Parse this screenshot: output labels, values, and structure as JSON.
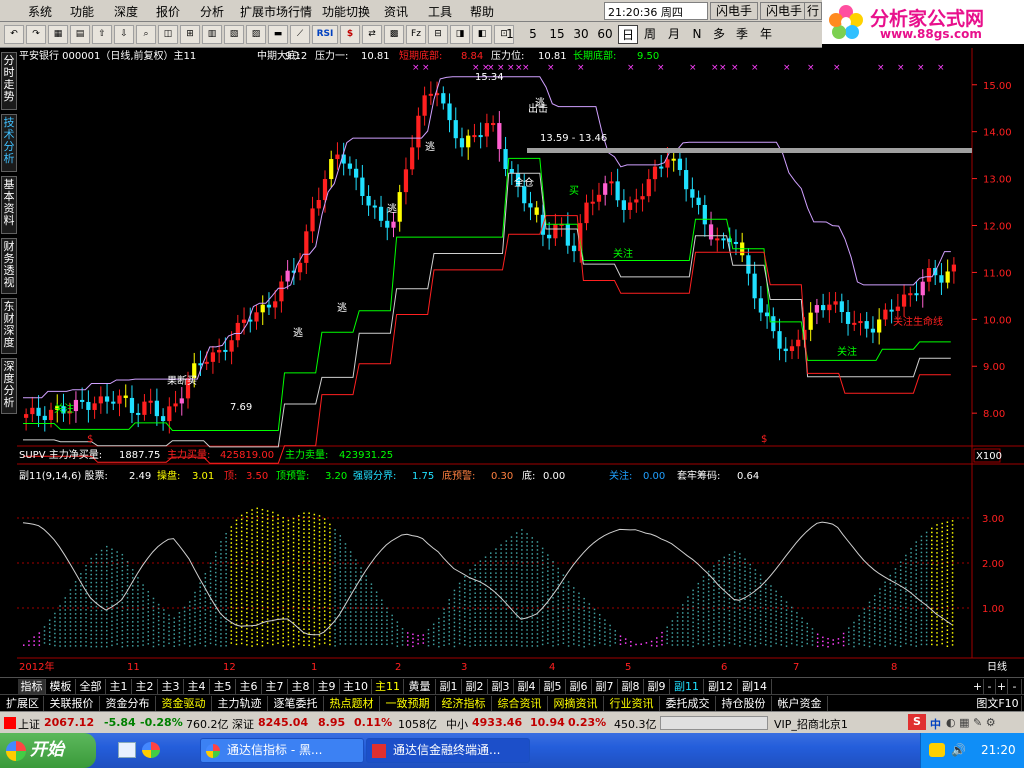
{
  "menubar": {
    "items": [
      "系统",
      "功能",
      "深度",
      "报价",
      "分析",
      "扩展市场行情",
      "功能切换",
      "资讯",
      "工具",
      "帮助"
    ],
    "clock": "21:20:36 周四",
    "buttons": [
      "闪电手",
      "闪电手",
      "行情",
      "资"
    ]
  },
  "logo": {
    "title": "分析家公式网",
    "url": "www.88gs.com"
  },
  "toolbar": {
    "icons": [
      "↶",
      "↷",
      "▦",
      "▤",
      "⇧",
      "⇩",
      "⌕",
      "◫",
      "⊞",
      "▥",
      "▧",
      "▨",
      "▬",
      "⟋",
      "RSI",
      "$",
      "⇄",
      "▩",
      "Fz",
      "⊟",
      "◨",
      "◧",
      "⊡"
    ],
    "periods": [
      "1",
      "5",
      "15",
      "30",
      "60",
      "日",
      "周",
      "月",
      "N",
      "多",
      "季",
      "年"
    ],
    "active_period": "日"
  },
  "sidetabs": [
    "分时走势",
    "技术分析",
    "基本资料",
    "财务透视",
    "东财深度",
    "深度分析"
  ],
  "main_header": {
    "stock": "平安银行 000001（日线,前复权）主11",
    "f1_label": "中期大底:",
    "f1_val": "9.12",
    "f2_label": "压力一:",
    "f2_val": "10.81",
    "f3_label": "短期底部:",
    "f3_val": "8.84",
    "f4_label": "压力位:",
    "f4_val": "10.81",
    "f5_label": "长期底部:",
    "f5_val": "9.50"
  },
  "price_axis": [
    "15.00",
    "14.00",
    "13.00",
    "12.00",
    "11.00",
    "10.00",
    "9.00",
    "8.00"
  ],
  "annotations": {
    "peak": "15.34",
    "escape": "逃",
    "strike": "出击",
    "full": "全仓",
    "buy": "买",
    "watch": "关注",
    "range": "13.59 - 13.46",
    "low": "7.69",
    "cut": "果断买",
    "lifeline": "关注生命线",
    "s_mark": "$"
  },
  "vol_header": {
    "name": "SUPV 主力净买量:",
    "net": "1887.75",
    "buy_label": "主力买量:",
    "buy": "425819.00",
    "sell_label": "主力卖量:",
    "sell": "423931.25"
  },
  "vol_scale": "X100",
  "sub_header": {
    "name": "副11(9,14,6) 股票:",
    "stock_val": "2.49",
    "op_label": "操盘:",
    "op_val": "3.01",
    "top_label": "顶:",
    "top_val": "3.50",
    "warn_label": "顶预警:",
    "warn_val": "3.20",
    "split_label": "强弱分界:",
    "split_val": "1.75",
    "bwarn_label": "底预警:",
    "bwarn_val": "0.30",
    "bottom_label": "底:",
    "bottom_val": "0.00",
    "focus_label": "关注:",
    "focus_val": "0.00",
    "trap_label": "套牢筹码:",
    "trap_val": "0.64"
  },
  "sub_axis": [
    "3.00",
    "2.00",
    "1.00"
  ],
  "date_axis": [
    "2012年",
    "11",
    "12",
    "1",
    "2",
    "3",
    "4",
    "5",
    "6",
    "7",
    "8"
  ],
  "date_corner": "日线",
  "bottom_tabs": [
    "指标",
    "模板",
    "全部",
    "主1",
    "主2",
    "主3",
    "主4",
    "主5",
    "主6",
    "主7",
    "主8",
    "主9",
    "主10",
    "主11",
    "黄量",
    "副1",
    "副2",
    "副3",
    "副4",
    "副5",
    "副6",
    "副7",
    "副8",
    "副9",
    "副11",
    "副12",
    "副14"
  ],
  "bottom_controls": [
    "+",
    "-",
    "+",
    "-"
  ],
  "sub_tabs": [
    "扩展区",
    "关联报价",
    "资金分布",
    "资金驱动",
    "主力轨迹",
    "逐笔委托",
    "热点题材",
    "一致预期",
    "经济指标",
    "综合资讯",
    "网摘资讯",
    "行业资讯",
    "委托成交",
    "持仓股份",
    "帐户资金"
  ],
  "sub_corner": "图文F10",
  "status": {
    "sh_label": "上证",
    "sh_val": "2067.12",
    "sh_chg": "-5.84",
    "sh_pct": "-0.28%",
    "sh_amt": "760.2亿",
    "sz_label": "深证",
    "sz_val": "8245.04",
    "sz_chg": "8.95",
    "sz_pct": "0.11%",
    "sz_amt": "1058亿",
    "zx_label": "中小",
    "zx_val": "4933.46",
    "zx_chg": "10.94",
    "zx_pct": "0.23%",
    "zx_amt": "450.3亿",
    "vip": "VIP_招商北京1"
  },
  "ime": "中",
  "taskbar": {
    "start": "开始",
    "task1": "通达信指标 - 黑...",
    "task2": "通达信金融终端通...",
    "time": "21:20"
  },
  "colors": {
    "red": "#ff2020",
    "cyan": "#20e0ff",
    "yellow": "#ffff00",
    "green": "#00ff00",
    "magenta": "#ff40ff",
    "pink": "#ff60d0"
  },
  "chart_data": {
    "type": "candlestick",
    "ylim": [
      7.3,
      15.4
    ],
    "x": [
      "2012-10",
      "2012-11",
      "2012-12",
      "2013-01",
      "2013-02",
      "2013-03",
      "2013-04",
      "2013-05",
      "2013-06",
      "2013-07",
      "2013-08"
    ],
    "close_series": [
      7.9,
      8.0,
      8.1,
      8.0,
      8.2,
      8.3,
      8.2,
      8.3,
      8.1,
      8.2,
      7.8,
      8.3,
      8.8,
      9.1,
      9.3,
      9.6,
      9.9,
      10.2,
      10.4,
      10.8,
      11.2,
      12.4,
      13.0,
      13.6,
      13.1,
      12.5,
      12.0,
      12.2,
      13.4,
      14.5,
      15.1,
      14.2,
      13.6,
      14.0,
      14.3,
      13.3,
      12.8,
      12.5,
      11.6,
      12.1,
      11.5,
      12.3,
      12.7,
      13.0,
      12.2,
      12.6,
      13.2,
      13.5,
      13.0,
      12.6,
      11.9,
      11.5,
      11.8,
      10.9,
      10.0,
      9.6,
      9.3,
      9.8,
      10.2,
      10.5,
      10.0,
      9.8,
      9.9,
      10.1,
      10.3,
      10.6,
      11.0,
      10.8,
      11.1
    ],
    "sub_series": [
      0.2,
      0.5,
      1.0,
      1.6,
      2.2,
      2.5,
      2.3,
      1.7,
      1.2,
      0.8,
      1.2,
      1.9,
      2.7,
      3.2,
      3.4,
      3.3,
      3.1,
      3.3,
      3.2,
      2.8,
      2.2,
      1.6,
      1.0,
      0.5,
      0.4,
      0.8,
      1.5,
      2.0,
      2.3,
      2.6,
      2.9,
      2.6,
      2.1,
      1.6,
      1.2,
      0.8,
      0.4,
      0.2,
      0.3,
      0.7,
      1.3,
      1.8,
      2.2,
      2.4,
      2.0,
      1.6,
      1.2,
      0.8,
      0.4,
      0.3,
      0.7,
      1.2,
      1.7,
      2.2,
      2.7,
      3.0,
      3.1
    ]
  }
}
